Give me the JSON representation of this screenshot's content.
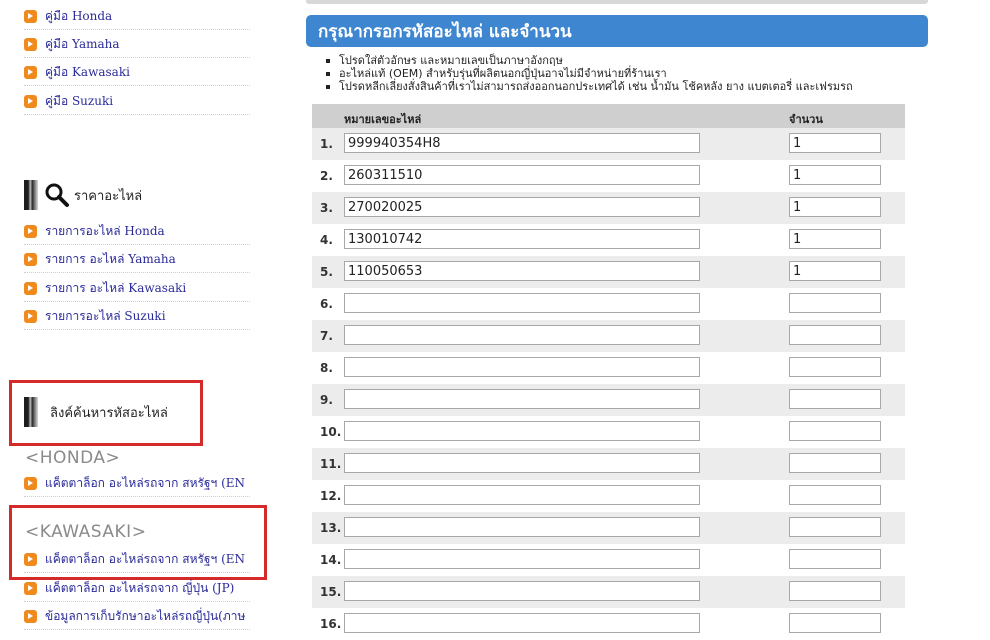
{
  "sidebar": {
    "manual_links": [
      "คู่มือ Honda",
      "คู่มือ Yamaha",
      "คู่มือ Kawasaki",
      "คู่มือ Suzuki"
    ],
    "price_section": {
      "title": "ราคาอะไหล่",
      "icon": "search-icon"
    },
    "price_links": [
      "รายการอะไหล่ Honda",
      "รายการ อะไหล่ Yamaha",
      "รายการ อะไหล่ Kawasaki",
      "รายการอะไหล่ Suzuki"
    ],
    "search_section": {
      "title": "ลิงค์ค้นหารหัสอะไหล่"
    },
    "honda_heading": "<HONDA>",
    "honda_links": [
      "แค็ตตาล็อก อะไหล่รถจาก สหรัฐฯ (EN"
    ],
    "kawasaki_heading": "<KAWASAKI>",
    "kawasaki_links": [
      "แค็ตตาล็อก อะไหล่รถจาก สหรัฐฯ (EN",
      "แค็ตตาล็อก อะไหล่รถจาก ญี่ปุ่น (JP)",
      "ข้อมูลการเก็บรักษาอะไหล่รถญี่ปุ่น(ภาษ"
    ]
  },
  "main": {
    "banner_title": "กรุณากรอกรหัสอะไหล่ และจำนวน",
    "notes": [
      "โปรดใส่ตัวอักษร และหมายเลขเป็นภาษาอังกฤษ",
      "อะไหล่แท้ (OEM) สำหรับรุ่นที่ผลิตนอกญี่ปุ่นอาจไม่มีจำหน่ายที่ร้านเรา",
      "โปรดหลีกเลี่ยงสั่งสินค้าที่เราไม่สามารถส่งออกนอกประเทศได้ เช่น น้ำมัน โช้คหลัง ยาง แบตเตอรี่ และเฟรมรถ"
    ],
    "table": {
      "col_part": "หมายเลขอะไหล่",
      "col_qty": "จำนวน",
      "rows": [
        {
          "num": "1.",
          "part": "999940354H8",
          "qty": "1"
        },
        {
          "num": "2.",
          "part": "260311510",
          "qty": "1"
        },
        {
          "num": "3.",
          "part": "270020025",
          "qty": "1"
        },
        {
          "num": "4.",
          "part": "130010742",
          "qty": "1"
        },
        {
          "num": "5.",
          "part": "110050653",
          "qty": "1"
        },
        {
          "num": "6.",
          "part": "",
          "qty": ""
        },
        {
          "num": "7.",
          "part": "",
          "qty": ""
        },
        {
          "num": "8.",
          "part": "",
          "qty": ""
        },
        {
          "num": "9.",
          "part": "",
          "qty": ""
        },
        {
          "num": "10.",
          "part": "",
          "qty": ""
        },
        {
          "num": "11.",
          "part": "",
          "qty": ""
        },
        {
          "num": "12.",
          "part": "",
          "qty": ""
        },
        {
          "num": "13.",
          "part": "",
          "qty": ""
        },
        {
          "num": "14.",
          "part": "",
          "qty": ""
        },
        {
          "num": "15.",
          "part": "",
          "qty": ""
        },
        {
          "num": "16.",
          "part": "",
          "qty": ""
        }
      ]
    }
  },
  "colors": {
    "banner": "#3e86cf",
    "bullet": "#f08a1c",
    "highlight_box": "#d42a2a",
    "link": "#2a2a9a"
  }
}
